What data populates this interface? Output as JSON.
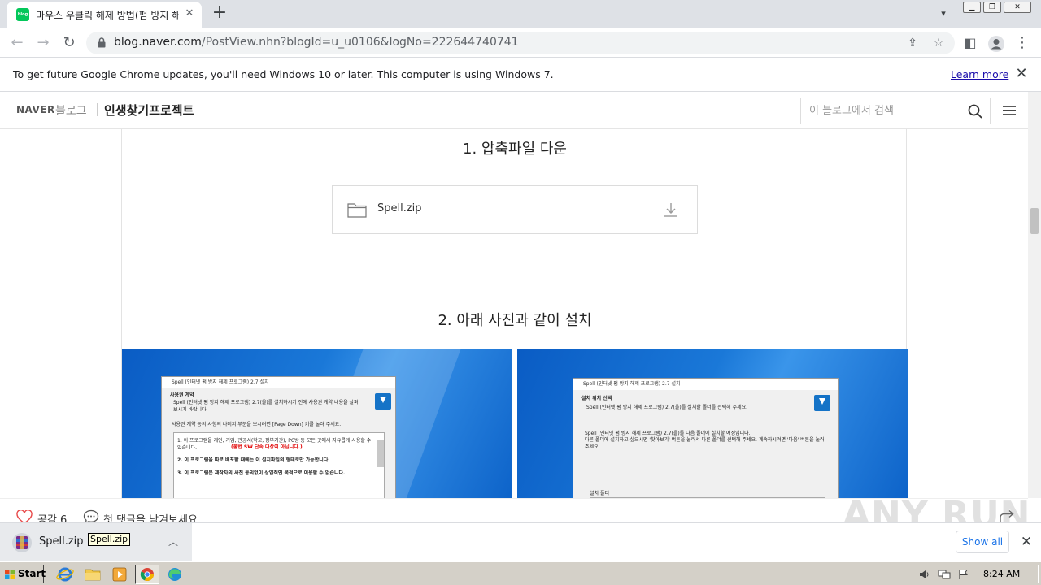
{
  "browser": {
    "tab_title": "마우스 우클릭 해제 방법(펌 방지 해제)",
    "favicon_text": "blog",
    "url_host": "blog.naver.com",
    "url_rest": "/PostView.nhn?blogId=u_u0106&logNo=222644740741",
    "infobar_text": "To get future Google Chrome updates, you'll need Windows 10 or later. This computer is using Windows 7.",
    "infobar_link": "Learn more"
  },
  "blog": {
    "logo": "NAVER",
    "blog_word": "블로그",
    "blog_name": "인생찾기프로젝트",
    "search_placeholder": "이 블로그에서 검색"
  },
  "post": {
    "step1": "1. 압축파일 다운",
    "attachment_name": "Spell.zip",
    "step2": "2. 아래 사진과 같이 설치",
    "shot_left": {
      "title": "Spell (인터넷 펌 방지 해제 프로그램) 2.7 설치",
      "heading": "사용권 계약",
      "subtitle": "Spell (인터넷 펌 방지 해제 프로그램) 2.7(을)를 설치하시기 전에 사용권 계약 내용을 살펴보시기 바랍니다.",
      "instruction": "사용권 계약 동의 사항의 나머지 부분을 보시려면 [Page Down] 키를 눌러 주세요.",
      "line1": "1. 이 프로그램을 개인, 기업, 관공서(학교, 정부기관), PC방 등 모든 곳에서 자유롭게 사용할 수 있습니다.",
      "line1_red": "(불법 SW 단속 대상이 아닙니다.)",
      "line2": "2. 이 프로그램을 따로 배포할 때에는 이 설치파일의 형태로만 가능합니다.",
      "line3": "3. 이 프로그램은 제작자의 사전 동의없이 상업적인 목적으로 이용할 수 없습니다."
    },
    "shot_right": {
      "title": "Spell (인터넷 펌 방지 해제 프로그램) 2.7 설치",
      "heading": "설치 위치 선택",
      "subtitle": "Spell (인터넷 펌 방지 해제 프로그램) 2.7(을)를 설치할 폴더를 선택해 주세요.",
      "body1": "Spell (인터넷 펌 방지 해제 프로그램) 2.7(을)를 다음 폴더에 설치할 예정입니다.",
      "body2": "다른 폴더에 설치하고 싶으시면 '찾아보기' 버튼을 눌러서 다른 폴더를 선택해 주세요. 계속하시려면 '다음' 버튼을 눌러 주세요.",
      "folder_label": "설치 폴더"
    }
  },
  "reactions": {
    "like_label": "공감 6",
    "comment_label": "첫 댓글을 남겨보세요"
  },
  "download_bar": {
    "file": "Spell.zip",
    "tooltip": "Spell.zip",
    "show_all": "Show all"
  },
  "taskbar": {
    "start": "Start",
    "clock": "8:24 AM"
  },
  "watermark": "ANY RUN"
}
